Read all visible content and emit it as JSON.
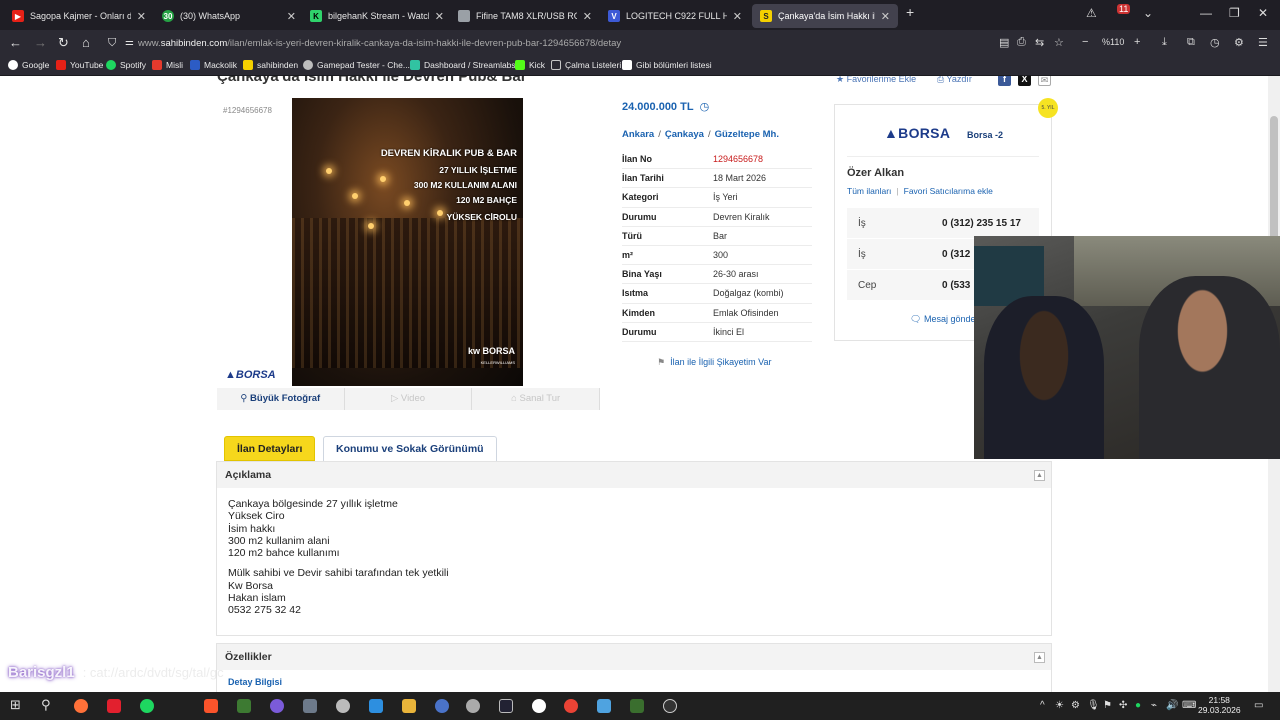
{
  "tabs": [
    {
      "title": "Sagopa Kajmer - Onları da",
      "favicon": "youtube-icon",
      "color": "#e62117"
    },
    {
      "title": "(30) WhatsApp",
      "favicon": "whatsapp-icon",
      "color": "#25a244",
      "badge": "30"
    },
    {
      "title": "bilgehanK Stream - Watch Live",
      "favicon": "kick-icon",
      "color": "#2fd36b"
    },
    {
      "title": "Fifine TAM8 XLR/USB RGB Beya",
      "favicon": "document-icon",
      "color": "#9aa0a6"
    },
    {
      "title": "LOGITECH C922 FULL HD STRE",
      "favicon": "v-icon",
      "color": "#3d5ad6"
    },
    {
      "title": "Çankaya'da İsim Hakkı ile Devre",
      "favicon": "sahibinden-icon",
      "color": "#f4d000"
    }
  ],
  "browser": {
    "url_prefix": "www.",
    "url_domain": "sahibinden.com",
    "url_path": "/ilan/emlak-is-yeri-devren-kiralik-cankaya-da-isim-hakki-ile-devren-pub-bar-1294656678/detay",
    "zoom": "%110",
    "notification_count": "11"
  },
  "bookmarks": [
    {
      "label": "Google",
      "color": "#ffffff"
    },
    {
      "label": "YouTube",
      "color": "#e62117"
    },
    {
      "label": "Spotify",
      "color": "#1ed760"
    },
    {
      "label": "Misli",
      "color": "#e63a2d"
    },
    {
      "label": "Mackolik",
      "color": "#2c5cc5"
    },
    {
      "label": "sahibinden",
      "color": "#f4d000"
    },
    {
      "label": "Gamepad Tester - Che...",
      "color": "#bdbdbd"
    },
    {
      "label": "Dashboard / Streamlabs",
      "color": "#31c3a2"
    },
    {
      "label": "Kick",
      "color": "#53fc18"
    },
    {
      "label": "Çalma Listeleri",
      "color": "#c7c7c7"
    },
    {
      "label": "Gibi bölümleri listesi",
      "color": "#ffffff"
    }
  ],
  "listing": {
    "title": "Çankaya'da İsim Hakkı ile Devren Pub& Bar",
    "id_label": "#1294656678",
    "favorite": "Favorilerime Ekle",
    "print": "Yazdır",
    "price": "24.000.000 TL",
    "location": {
      "city": "Ankara",
      "district": "Çankaya",
      "neighborhood": "Güzeltepe Mh."
    },
    "photo_lines": [
      "DEVREN KİRALIK PUB & BAR",
      "27 YILLIK İŞLETME",
      "300 M2 KULLANIM ALANI",
      "120 M2 BAHÇE",
      "YÜKSEK CİROLU"
    ],
    "photo_logo": "kw BORSA",
    "photo_logo_sub": "KELLERWILLIAMS",
    "photo_brand": "BORSA",
    "photo_tools": [
      "Büyük Fotoğraf",
      "Video",
      "Sanal Tur"
    ],
    "info": [
      {
        "k": "İlan No",
        "v": "1294656678"
      },
      {
        "k": "İlan Tarihi",
        "v": "18 Mart 2026"
      },
      {
        "k": "Kategori",
        "v": "İş Yeri"
      },
      {
        "k": "Durumu",
        "v": "Devren Kiralık"
      },
      {
        "k": "Türü",
        "v": "Bar"
      },
      {
        "k": "m²",
        "v": "300"
      },
      {
        "k": "Bina Yaşı",
        "v": "26-30 arası"
      },
      {
        "k": "Isıtma",
        "v": "Doğalgaz (kombi)"
      },
      {
        "k": "Kimden",
        "v": "Emlak Ofisinden"
      },
      {
        "k": "Durumu",
        "v": "İkinci El"
      }
    ],
    "complaint": "İlan ile İlgili Şikayetim Var"
  },
  "seller": {
    "badge": "5. YIL",
    "logo": "BORSA",
    "store": "Borsa -2",
    "name": "Özer Alkan",
    "link_all": "Tüm ilanları",
    "link_fav": "Favori Satıcılarıma ekle",
    "phones": [
      {
        "k": "İş",
        "v": "0 (312) 235 15 17"
      },
      {
        "k": "İş",
        "v": "0 (312"
      },
      {
        "k": "Cep",
        "v": "0 (533"
      }
    ],
    "message": "Mesaj gönde"
  },
  "detail_tabs": [
    "İlan Detayları",
    "Konumu ve Sokak Görünümü"
  ],
  "description": {
    "heading": "Açıklama",
    "lines_a": [
      "Çankaya bölgesinde 27 yıllık işletme",
      "Yüksek Ciro",
      "İsim hakkı",
      "300 m2 kullanim alani",
      "120 m2 bahce kullanımı"
    ],
    "lines_b": [
      "Mülk sahibi ve Devir sahibi tarafından tek yetkili",
      "Kw Borsa",
      "Hakan islam",
      "0532 275 32 42"
    ]
  },
  "features": {
    "heading": "Özellikler",
    "link": "Detay Bilgisi"
  },
  "overlay": {
    "watermark": "Barisgzl1",
    "chat_faded": ": cat://ardc/dvdt/sg/tal/gc"
  },
  "clock": {
    "time": "21:58",
    "date": "29.03.2026"
  }
}
